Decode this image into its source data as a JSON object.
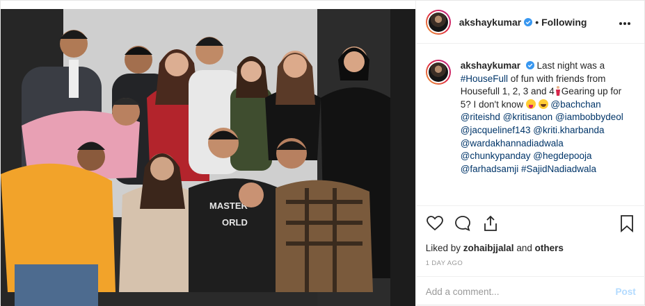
{
  "post": {
    "photo_alt": "Group photo of actors",
    "author": {
      "username": "akshaykumar",
      "verified": true,
      "follow_status": "Following"
    },
    "caption": {
      "username": "akshaykumar",
      "text_1": "Last night was a",
      "hashtag_1": "#HouseFull",
      "text_2": "of fun with friends from Housefull 1, 2, 3 and 4",
      "text_3": "Gearing up for 5? I don't know",
      "mentions": [
        "@bachchan",
        "@riteishd",
        "@kritisanon",
        "@iambobbydeol",
        "@jacquelinef143",
        "@kriti.kharbanda",
        "@wardakhannadiadwala",
        "@chunkypanday",
        "@hegdepooja",
        "@farhadsamji"
      ],
      "hashtag_2": "#SajidNadiadwala"
    },
    "actions": {
      "like_icon": "heart-icon",
      "comment_icon": "comment-icon",
      "share_icon": "share-icon",
      "save_icon": "bookmark-icon"
    },
    "likes": {
      "prefix": "Liked by",
      "user": "zohaibjjalal",
      "joiner": "and",
      "others": "others"
    },
    "timestamp": "1 day ago",
    "comment": {
      "placeholder": "Add a comment...",
      "post_label": "Post"
    }
  },
  "colors": {
    "link": "#003569",
    "verified": "#3897f0",
    "post_button": "#b3dbff",
    "meta": "#999999"
  }
}
